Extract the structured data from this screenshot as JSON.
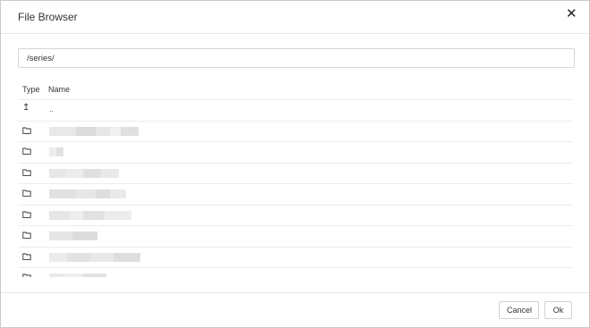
{
  "dialog": {
    "title": "File Browser",
    "close_icon": "close-icon"
  },
  "path": {
    "value": "/series/"
  },
  "columns": {
    "type": "Type",
    "name": "Name"
  },
  "rows": [
    {
      "kind": "up",
      "icon": "up-arrow-icon",
      "name": ".."
    },
    {
      "kind": "folder",
      "icon": "folder-icon",
      "name": ""
    },
    {
      "kind": "folder",
      "icon": "folder-icon",
      "name": ""
    },
    {
      "kind": "folder",
      "icon": "folder-icon",
      "name": ""
    },
    {
      "kind": "folder",
      "icon": "folder-icon",
      "name": ""
    },
    {
      "kind": "folder",
      "icon": "folder-icon",
      "name": ""
    },
    {
      "kind": "folder",
      "icon": "folder-icon",
      "name": ""
    },
    {
      "kind": "folder",
      "icon": "folder-icon",
      "name": ""
    },
    {
      "kind": "folder",
      "icon": "folder-icon",
      "name": ""
    }
  ],
  "buttons": {
    "cancel": "Cancel",
    "ok": "Ok"
  },
  "colors": {
    "border": "#c9c9c9",
    "divider": "#ececec",
    "text": "#333333",
    "blurred": "#e3e3e3"
  }
}
